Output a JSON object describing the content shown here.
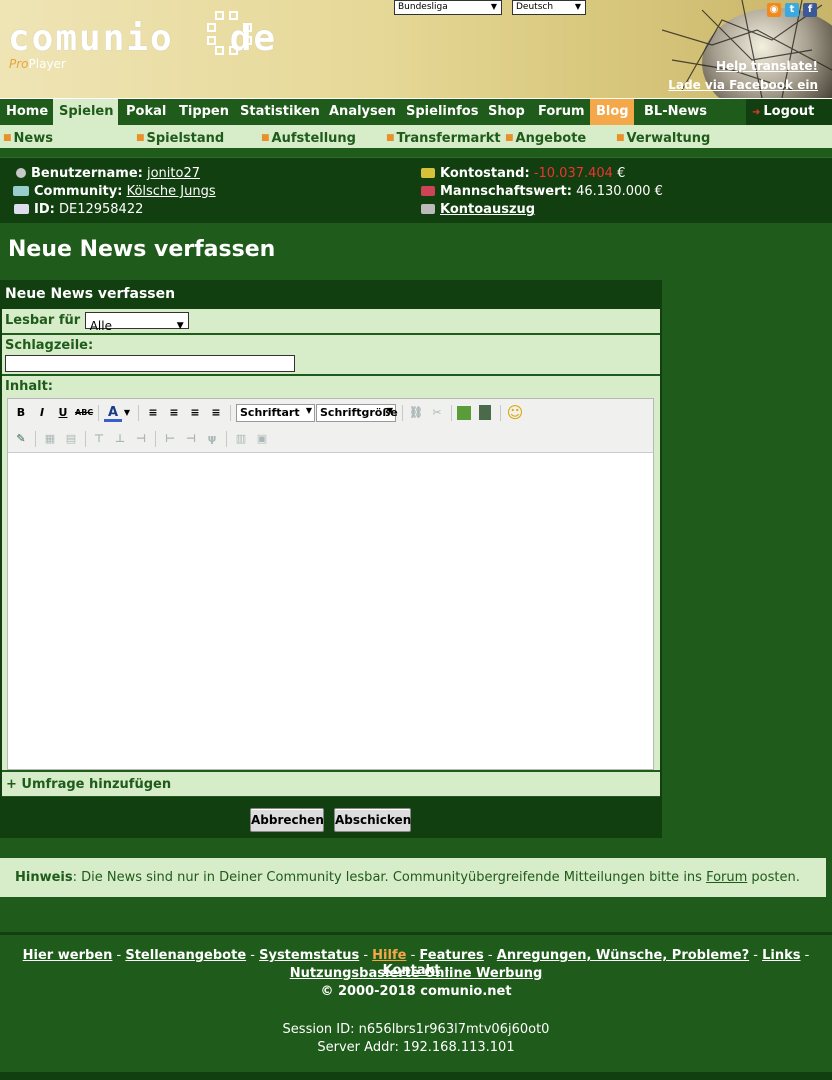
{
  "header": {
    "logo_text": "comunio",
    "logo_suffix": "de",
    "pro_label": "Pro",
    "player_label": "Player",
    "league_select": "Bundesliga",
    "language_select": "Deutsch",
    "help_translate": "Help translate!",
    "facebook_load": "Lade via Facebook ein"
  },
  "nav": {
    "items": [
      "Home",
      "Spielen",
      "Pokal",
      "Tippen",
      "Statistiken",
      "Analysen",
      "Spielinfos",
      "Shop",
      "Forum",
      "Blog",
      "BL-News"
    ],
    "active": "Spielen",
    "logout": "Logout"
  },
  "subnav": {
    "items": [
      "News",
      "Spielstand",
      "Aufstellung",
      "Transfermarkt",
      "Angebote",
      "Verwaltung"
    ]
  },
  "user": {
    "username_label": "Benutzername:",
    "username": "jonito27",
    "community_label": "Community:",
    "community": "Kölsche Jungs",
    "id_label": "ID:",
    "id": "DE12958422",
    "balance_label": "Kontostand:",
    "balance": "-10.037.404",
    "currency": "€",
    "team_value_label": "Mannschaftswert:",
    "team_value": "46.130.000 €",
    "statement_link": "Kontoauszug"
  },
  "page": {
    "title": "Neue News verfassen"
  },
  "form": {
    "panel_title": "Neue News verfassen",
    "readable_label": "Lesbar für",
    "readable_value": "Alle",
    "headline_label": "Schlagzeile:",
    "headline_value": "",
    "content_label": "Inhalt:",
    "font_dropdown": "Schriftart",
    "size_dropdown": "Schriftgröße",
    "poll_toggle": "+ Umfrage hinzufügen",
    "cancel_button": "Abbrechen",
    "submit_button": "Abschicken"
  },
  "hint": {
    "label": "Hinweis",
    "text_before": ": Die News sind nur in Deiner Community lesbar. Communityübergreifende Mitteilungen bitte ins ",
    "forum_link": "Forum",
    "text_after": " posten."
  },
  "footer": {
    "links": [
      "Hier werben",
      "Stellenangebote",
      "Systemstatus",
      "Hilfe",
      "Features",
      "Anregungen, Wünsche, Probleme?",
      "Links",
      "Kontakt"
    ],
    "ad_link": "Nutzungsbasierte Online Werbung",
    "copyright": "© 2000-2018 comunio.net",
    "session": "Session ID: n656lbrs1r963l7mtv06j60ot0",
    "server": "Server Addr: 192.168.113.101"
  },
  "colors": {
    "dark_green": "#1f5b1a",
    "darker_green": "#123f0f",
    "light_green": "#d7ecc8",
    "orange": "#f5a84a",
    "negative": "#e33333"
  }
}
